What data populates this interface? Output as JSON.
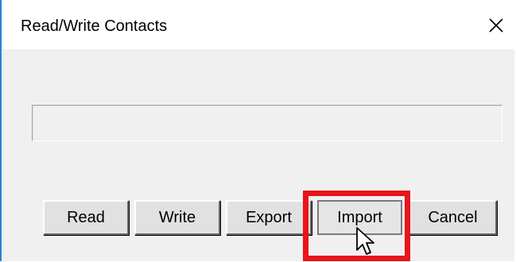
{
  "window": {
    "title": "Read/Write Contacts",
    "close_symbol": "✕",
    "accent_color": "#2b7fd9"
  },
  "progress": {
    "value": 0
  },
  "buttons": {
    "read": "Read",
    "write": "Write",
    "export": "Export",
    "import": "Import",
    "cancel": "Cancel"
  },
  "annotation": {
    "highlight_color": "#e8151b",
    "highlighted_button": "Import"
  },
  "icons": {
    "close": "close-icon",
    "cursor": "mouse-pointer-icon"
  }
}
